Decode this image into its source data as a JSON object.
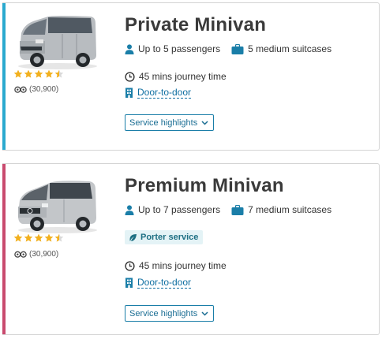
{
  "colors": {
    "accent_private": "#2aa9cf",
    "accent_premium": "#c94a6e",
    "link": "#0e6ea1",
    "star": "#f2b01e"
  },
  "cards": [
    {
      "title": "Private Minivan",
      "rating": 4.5,
      "reviews": "(30,900)",
      "passengers": "Up to 5 passengers",
      "luggage": "5 medium suitcases",
      "badge": "",
      "journey": "45 mins journey time",
      "door": "Door-to-door",
      "highlights": "Service highlights"
    },
    {
      "title": "Premium Minivan",
      "rating": 4.5,
      "reviews": "(30,900)",
      "passengers": "Up to 7 passengers",
      "luggage": "7 medium suitcases",
      "badge": "Porter service",
      "journey": "45 mins journey time",
      "door": "Door-to-door",
      "highlights": "Service highlights"
    }
  ],
  "icons": {
    "passengers": "person-icon",
    "luggage": "suitcase-icon",
    "journey": "clock-icon",
    "door": "building-icon",
    "badge": "leaf-icon",
    "highlights": "chevron-down-icon",
    "reviews": "tripadvisor-icon"
  }
}
